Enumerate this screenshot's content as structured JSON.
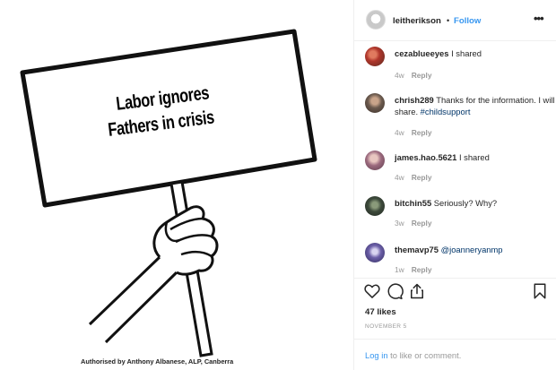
{
  "sign": {
    "line1": "Labor ignores",
    "line2": "Fathers in crisis",
    "authorised": "Authorised by Anthony Albanese, ALP, Canberra"
  },
  "header": {
    "username": "leitherikson",
    "separator": "•",
    "follow_label": "Follow",
    "more_icon": "more-horizontal-icon",
    "more_label": "•••"
  },
  "comments": [
    {
      "user": "cezablueeyes",
      "text": "I shared",
      "tag": "",
      "age": "4w",
      "reply": "Reply",
      "avatar_color": "#b0362b"
    },
    {
      "user": "chrish289",
      "text": "Thanks for the information. I will share.",
      "tag": "#childsupport",
      "age": "4w",
      "reply": "Reply",
      "avatar_color": "#6b5a4e"
    },
    {
      "user": "james.hao.5621",
      "text": "I shared",
      "tag": "",
      "age": "4w",
      "reply": "Reply",
      "avatar_color": "#9c6a7e"
    },
    {
      "user": "bitchin55",
      "text": "Seriously? Why?",
      "tag": "",
      "age": "3w",
      "reply": "Reply",
      "avatar_color": "#3d4a3b"
    },
    {
      "user": "themavp75",
      "text": "",
      "tag": "@joanneryanmp",
      "age": "1w",
      "reply": "Reply",
      "avatar_color": "#6c5fa8"
    }
  ],
  "actions": {
    "like_icon": "heart-icon",
    "comment_icon": "comment-icon",
    "share_icon": "share-icon",
    "save_icon": "bookmark-icon"
  },
  "likes": "47 likes",
  "date": "NOVEMBER 5",
  "footer": {
    "login_label": "Log in",
    "rest": " to like or comment."
  },
  "colors": {
    "accent": "#3897f0",
    "hashtag": "#003569",
    "muted": "#999999",
    "border": "#efefef"
  }
}
